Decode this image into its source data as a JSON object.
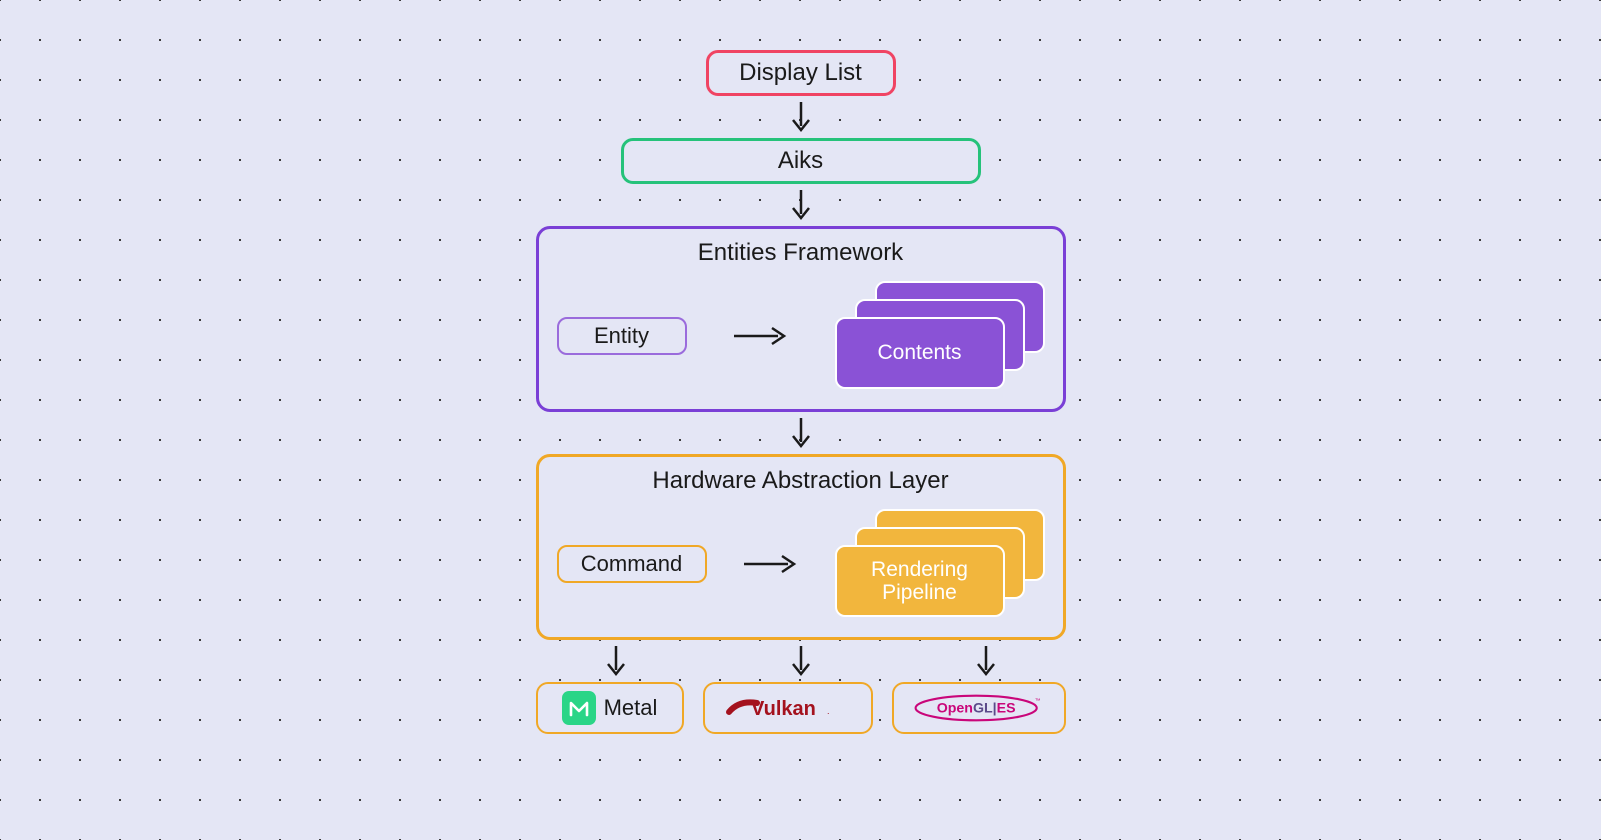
{
  "nodes": {
    "display_list": "Display List",
    "aiks": "Aiks",
    "entities_framework": "Entities Framework",
    "entity": "Entity",
    "contents": "Contents",
    "hal": "Hardware Abstraction Layer",
    "command": "Command",
    "rendering_pipeline": "Rendering\nPipeline",
    "metal": "Metal",
    "vulkan": "Vulkan.",
    "opengles": "OpenGL|ES"
  },
  "colors": {
    "red": "#f04463",
    "green": "#25c27a",
    "purple": "#7a3fd6",
    "purple_fill": "#8a52d6",
    "orange": "#f0a826",
    "orange_fill": "#f2b63d",
    "bg": "#e4e6f5"
  },
  "chart_data": {
    "type": "diagram",
    "title": "",
    "nodes": [
      {
        "id": "display_list",
        "label": "Display List",
        "color": "red"
      },
      {
        "id": "aiks",
        "label": "Aiks",
        "color": "green"
      },
      {
        "id": "entities_framework",
        "label": "Entities Framework",
        "color": "purple",
        "children": [
          {
            "id": "entity",
            "label": "Entity"
          },
          {
            "id": "contents",
            "label": "Contents",
            "stacked": true
          }
        ]
      },
      {
        "id": "hal",
        "label": "Hardware Abstraction Layer",
        "color": "orange",
        "children": [
          {
            "id": "command",
            "label": "Command"
          },
          {
            "id": "rendering_pipeline",
            "label": "Rendering Pipeline",
            "stacked": true
          }
        ]
      },
      {
        "id": "metal",
        "label": "Metal",
        "color": "orange"
      },
      {
        "id": "vulkan",
        "label": "Vulkan.",
        "color": "orange"
      },
      {
        "id": "opengles",
        "label": "OpenGL|ES",
        "color": "orange"
      }
    ],
    "edges": [
      [
        "display_list",
        "aiks"
      ],
      [
        "aiks",
        "entities_framework"
      ],
      [
        "entity",
        "contents"
      ],
      [
        "entities_framework",
        "hal"
      ],
      [
        "command",
        "rendering_pipeline"
      ],
      [
        "hal",
        "metal"
      ],
      [
        "hal",
        "vulkan"
      ],
      [
        "hal",
        "opengles"
      ]
    ]
  }
}
